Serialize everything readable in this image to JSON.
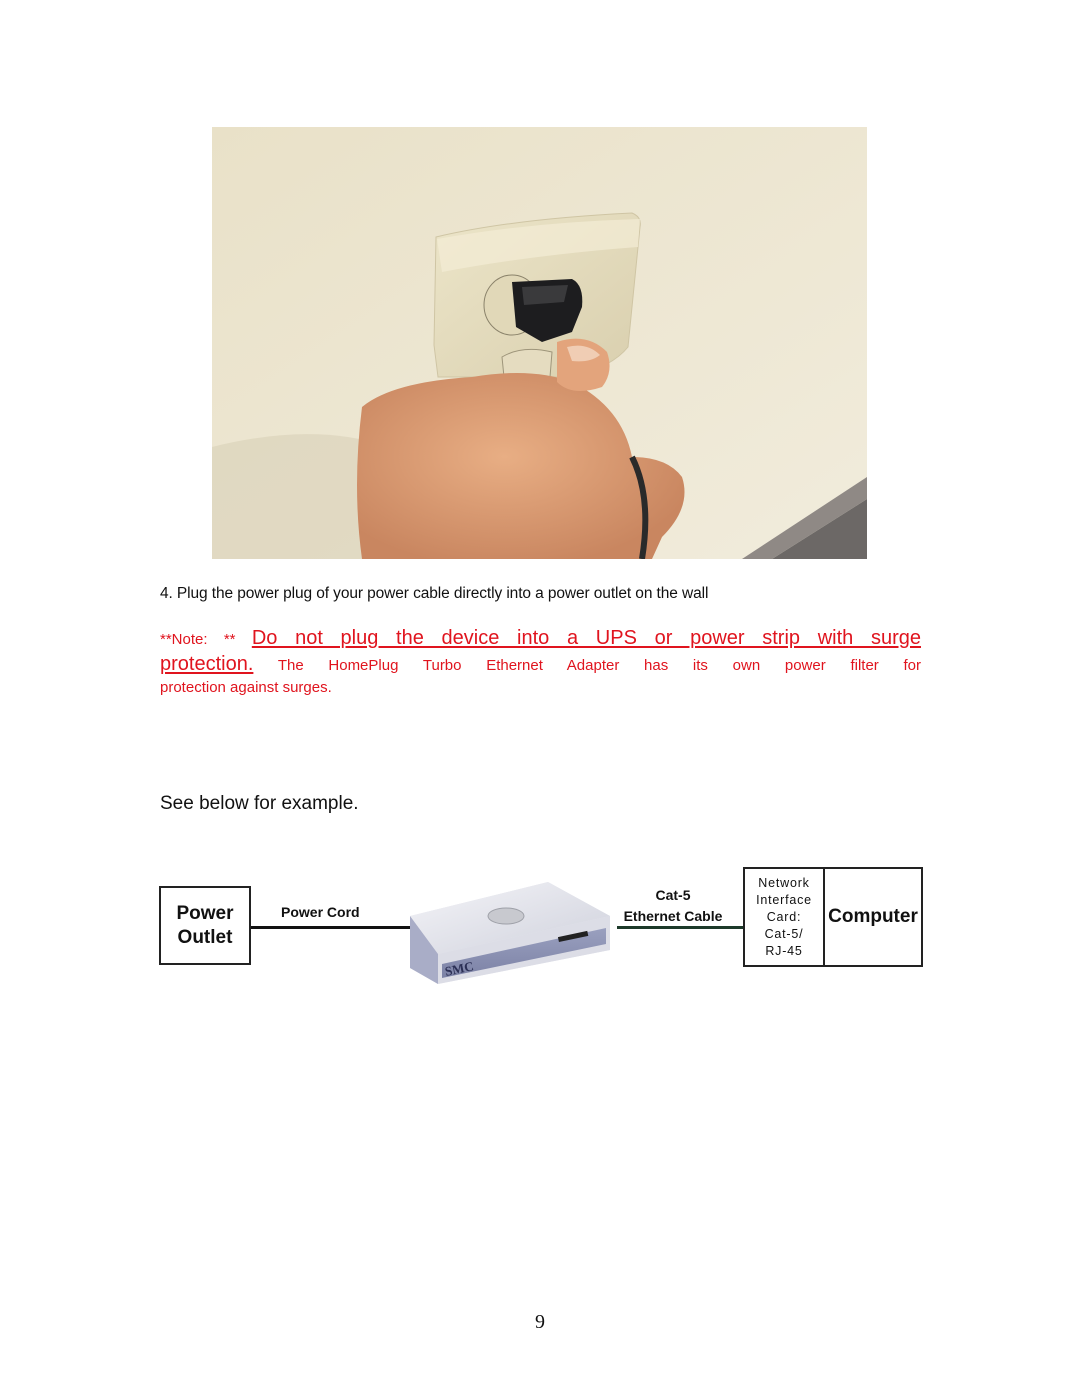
{
  "photo": {
    "description": "Hand plugging a black power plug into a wall outlet"
  },
  "instructions": {
    "step4": "4. Plug the power plug of your power cable directly into a power outlet on the wall"
  },
  "note": {
    "prefix": "**Note: ** ",
    "warning_line1": "Do not plug the device into a UPS or power strip with surge",
    "warning_line2": "protection.",
    "explanation_part1": " The HomePlug Turbo Ethernet Adapter has its own power filter for",
    "explanation_part2": "protection against surges.",
    "color": "#e0141e"
  },
  "see_below": "See below for example.",
  "diagram": {
    "outlet_box": {
      "line1": "Power",
      "line2": "Outlet"
    },
    "power_cord_label": "Power Cord",
    "device_brand": "SMC",
    "ethernet_label": {
      "line1": "Cat-5",
      "line2": "Ethernet Cable"
    },
    "nic_box": {
      "lines": [
        "Network",
        "Interface",
        "Card:",
        "Cat-5/",
        "RJ-45"
      ]
    },
    "computer_label": "Computer"
  },
  "page_number": "9"
}
